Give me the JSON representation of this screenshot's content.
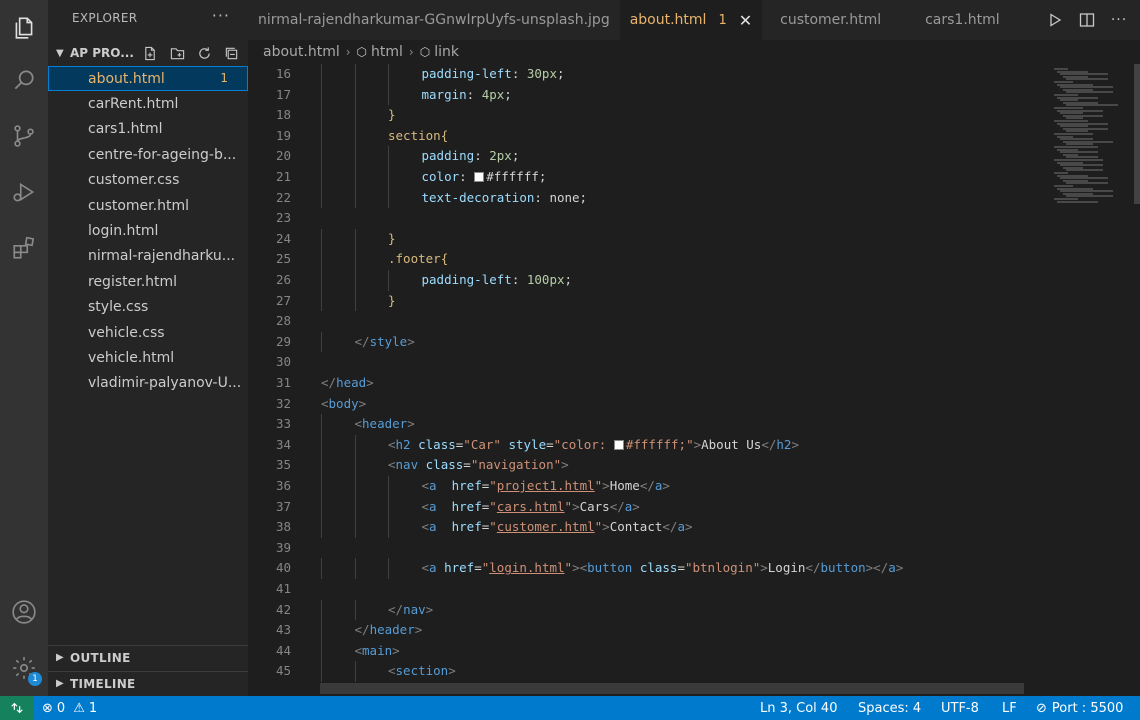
{
  "colors": {
    "accent": "#007acc",
    "modified_file": "#e8b46b",
    "remote": "#16825d"
  },
  "activity_bar": {
    "icons": [
      "files-icon",
      "search-icon",
      "source-control-icon",
      "run-debug-icon",
      "extensions-icon",
      "account-icon",
      "settings-icon"
    ],
    "settings_badge": "1"
  },
  "sidebar": {
    "title": "EXPLORER",
    "more": "···",
    "project": "AP PRO...",
    "files": [
      {
        "name": "about.html",
        "badge": "1",
        "active": true
      },
      {
        "name": "carRent.html"
      },
      {
        "name": "cars1.html"
      },
      {
        "name": "centre-for-ageing-b..."
      },
      {
        "name": "customer.css"
      },
      {
        "name": "customer.html"
      },
      {
        "name": "login.html"
      },
      {
        "name": "nirmal-rajendharku..."
      },
      {
        "name": "register.html"
      },
      {
        "name": "style.css"
      },
      {
        "name": "vehicle.css"
      },
      {
        "name": "vehicle.html"
      },
      {
        "name": "vladimir-palyanov-U..."
      }
    ],
    "outline": "OUTLINE",
    "timeline": "TIMELINE"
  },
  "tabs": [
    {
      "label": "nirmal-rajendharkumar-GGnwIrpUyfs-unsplash.jpg"
    },
    {
      "label": "about.html",
      "badge": "1",
      "active": true
    },
    {
      "label": "customer.html"
    },
    {
      "label": "cars1.html"
    }
  ],
  "breadcrumb": {
    "file": "about.html",
    "items": [
      "html",
      "link"
    ]
  },
  "editor": {
    "lines": [
      {
        "n": "16",
        "indent": 3,
        "tokens": [
          [
            "t-prop",
            "padding-left"
          ],
          [
            "t-txt",
            ": "
          ],
          [
            "t-val",
            "30px"
          ],
          [
            "t-txt",
            ";"
          ]
        ]
      },
      {
        "n": "17",
        "indent": 3,
        "tokens": [
          [
            "t-prop",
            "margin"
          ],
          [
            "t-txt",
            ": "
          ],
          [
            "t-val",
            "4px"
          ],
          [
            "t-txt",
            ";"
          ]
        ]
      },
      {
        "n": "18",
        "indent": 2,
        "tokens": [
          [
            "t-brace",
            "}"
          ]
        ]
      },
      {
        "n": "19",
        "indent": 2,
        "tokens": [
          [
            "t-sel",
            "section"
          ],
          [
            "t-brace",
            "{"
          ]
        ]
      },
      {
        "n": "20",
        "indent": 3,
        "tokens": [
          [
            "t-prop",
            "padding"
          ],
          [
            "t-txt",
            ": "
          ],
          [
            "t-val",
            "2px"
          ],
          [
            "t-txt",
            ";"
          ]
        ]
      },
      {
        "n": "21",
        "indent": 3,
        "tokens": [
          [
            "t-prop",
            "color"
          ],
          [
            "t-txt",
            ": "
          ],
          [
            "swatch",
            ""
          ],
          [
            "t-txt",
            "#ffffff;"
          ]
        ]
      },
      {
        "n": "22",
        "indent": 3,
        "tokens": [
          [
            "t-prop",
            "text-decoration"
          ],
          [
            "t-txt",
            ": none;"
          ]
        ]
      },
      {
        "n": "23",
        "indent": 0,
        "tokens": []
      },
      {
        "n": "24",
        "indent": 2,
        "tokens": [
          [
            "t-brace",
            "}"
          ]
        ]
      },
      {
        "n": "25",
        "indent": 2,
        "tokens": [
          [
            "t-sel",
            ".footer"
          ],
          [
            "t-brace",
            "{"
          ]
        ]
      },
      {
        "n": "26",
        "indent": 3,
        "tokens": [
          [
            "t-prop",
            "padding-left"
          ],
          [
            "t-txt",
            ": "
          ],
          [
            "t-val",
            "100px"
          ],
          [
            "t-txt",
            ";"
          ]
        ]
      },
      {
        "n": "27",
        "indent": 2,
        "tokens": [
          [
            "t-brace",
            "}"
          ]
        ]
      },
      {
        "n": "28",
        "indent": 0,
        "tokens": []
      },
      {
        "n": "29",
        "indent": 1,
        "tokens": [
          [
            "t-ang",
            "</"
          ],
          [
            "t-tag",
            "style"
          ],
          [
            "t-ang",
            ">"
          ]
        ]
      },
      {
        "n": "30",
        "indent": 0,
        "tokens": []
      },
      {
        "n": "31",
        "indent": 0,
        "tokens": [
          [
            "t-ang",
            "</"
          ],
          [
            "t-tag",
            "head"
          ],
          [
            "t-ang",
            ">"
          ]
        ]
      },
      {
        "n": "32",
        "indent": 0,
        "tokens": [
          [
            "t-ang",
            "<"
          ],
          [
            "t-tag",
            "body"
          ],
          [
            "t-ang",
            ">"
          ]
        ]
      },
      {
        "n": "33",
        "indent": 1,
        "tokens": [
          [
            "t-ang",
            "<"
          ],
          [
            "t-tag",
            "header"
          ],
          [
            "t-ang",
            ">"
          ]
        ]
      },
      {
        "n": "34",
        "indent": 2,
        "tokens": [
          [
            "t-ang",
            "<"
          ],
          [
            "t-tag",
            "h2"
          ],
          [
            "t-txt",
            " "
          ],
          [
            "t-attr",
            "class"
          ],
          [
            "t-txt",
            "="
          ],
          [
            "t-str",
            "\"Car\""
          ],
          [
            "t-txt",
            " "
          ],
          [
            "t-attr",
            "style"
          ],
          [
            "t-txt",
            "="
          ],
          [
            "t-str",
            "\"color: "
          ],
          [
            "swatch",
            ""
          ],
          [
            "t-str",
            "#ffffff;\""
          ],
          [
            "t-ang",
            ">"
          ],
          [
            "t-txt",
            "About Us"
          ],
          [
            "t-ang",
            "</"
          ],
          [
            "t-tag",
            "h2"
          ],
          [
            "t-ang",
            ">"
          ]
        ]
      },
      {
        "n": "35",
        "indent": 2,
        "tokens": [
          [
            "t-ang",
            "<"
          ],
          [
            "t-tag",
            "nav"
          ],
          [
            "t-txt",
            " "
          ],
          [
            "t-attr",
            "class"
          ],
          [
            "t-txt",
            "="
          ],
          [
            "t-str",
            "\"navigation\""
          ],
          [
            "t-ang",
            ">"
          ]
        ]
      },
      {
        "n": "36",
        "indent": 3,
        "tokens": [
          [
            "t-ang",
            "<"
          ],
          [
            "t-tag",
            "a"
          ],
          [
            "t-txt",
            "  "
          ],
          [
            "t-attr",
            "href"
          ],
          [
            "t-txt",
            "="
          ],
          [
            "t-str",
            "\""
          ],
          [
            "t-link",
            "project1.html"
          ],
          [
            "t-str",
            "\""
          ],
          [
            "t-ang",
            ">"
          ],
          [
            "t-txt",
            "Home"
          ],
          [
            "t-ang",
            "</"
          ],
          [
            "t-tag",
            "a"
          ],
          [
            "t-ang",
            ">"
          ]
        ]
      },
      {
        "n": "37",
        "indent": 3,
        "tokens": [
          [
            "t-ang",
            "<"
          ],
          [
            "t-tag",
            "a"
          ],
          [
            "t-txt",
            "  "
          ],
          [
            "t-attr",
            "href"
          ],
          [
            "t-txt",
            "="
          ],
          [
            "t-str",
            "\""
          ],
          [
            "t-link",
            "cars.html"
          ],
          [
            "t-str",
            "\""
          ],
          [
            "t-ang",
            ">"
          ],
          [
            "t-txt",
            "Cars"
          ],
          [
            "t-ang",
            "</"
          ],
          [
            "t-tag",
            "a"
          ],
          [
            "t-ang",
            ">"
          ]
        ]
      },
      {
        "n": "38",
        "indent": 3,
        "tokens": [
          [
            "t-ang",
            "<"
          ],
          [
            "t-tag",
            "a"
          ],
          [
            "t-txt",
            "  "
          ],
          [
            "t-attr",
            "href"
          ],
          [
            "t-txt",
            "="
          ],
          [
            "t-str",
            "\""
          ],
          [
            "t-link",
            "customer.html"
          ],
          [
            "t-str",
            "\""
          ],
          [
            "t-ang",
            ">"
          ],
          [
            "t-txt",
            "Contact"
          ],
          [
            "t-ang",
            "</"
          ],
          [
            "t-tag",
            "a"
          ],
          [
            "t-ang",
            ">"
          ]
        ]
      },
      {
        "n": "39",
        "indent": 0,
        "tokens": []
      },
      {
        "n": "40",
        "indent": 3,
        "tokens": [
          [
            "t-ang",
            "<"
          ],
          [
            "t-tag",
            "a"
          ],
          [
            "t-txt",
            " "
          ],
          [
            "t-attr",
            "href"
          ],
          [
            "t-txt",
            "="
          ],
          [
            "t-str",
            "\""
          ],
          [
            "t-link",
            "login.html"
          ],
          [
            "t-str",
            "\""
          ],
          [
            "t-ang",
            "><"
          ],
          [
            "t-tag",
            "button"
          ],
          [
            "t-txt",
            " "
          ],
          [
            "t-attr",
            "class"
          ],
          [
            "t-txt",
            "="
          ],
          [
            "t-str",
            "\"btnlogin\""
          ],
          [
            "t-ang",
            ">"
          ],
          [
            "t-txt",
            "Login"
          ],
          [
            "t-ang",
            "</"
          ],
          [
            "t-tag",
            "button"
          ],
          [
            "t-ang",
            "></"
          ],
          [
            "t-tag",
            "a"
          ],
          [
            "t-ang",
            ">"
          ]
        ]
      },
      {
        "n": "41",
        "indent": 0,
        "tokens": []
      },
      {
        "n": "42",
        "indent": 2,
        "tokens": [
          [
            "t-ang",
            "</"
          ],
          [
            "t-tag",
            "nav"
          ],
          [
            "t-ang",
            ">"
          ]
        ]
      },
      {
        "n": "43",
        "indent": 1,
        "tokens": [
          [
            "t-ang",
            "</"
          ],
          [
            "t-tag",
            "header"
          ],
          [
            "t-ang",
            ">"
          ]
        ]
      },
      {
        "n": "44",
        "indent": 1,
        "tokens": [
          [
            "t-ang",
            "<"
          ],
          [
            "t-tag",
            "main"
          ],
          [
            "t-ang",
            ">"
          ]
        ]
      },
      {
        "n": "45",
        "indent": 2,
        "tokens": [
          [
            "t-ang",
            "<"
          ],
          [
            "t-tag",
            "section"
          ],
          [
            "t-ang",
            ">"
          ]
        ]
      }
    ]
  },
  "status": {
    "errors": "0",
    "warnings": "1",
    "position": "Ln 3, Col 40",
    "spaces": "Spaces: 4",
    "encoding": "UTF-8",
    "eol": "LF",
    "port": "Port : 5500"
  }
}
